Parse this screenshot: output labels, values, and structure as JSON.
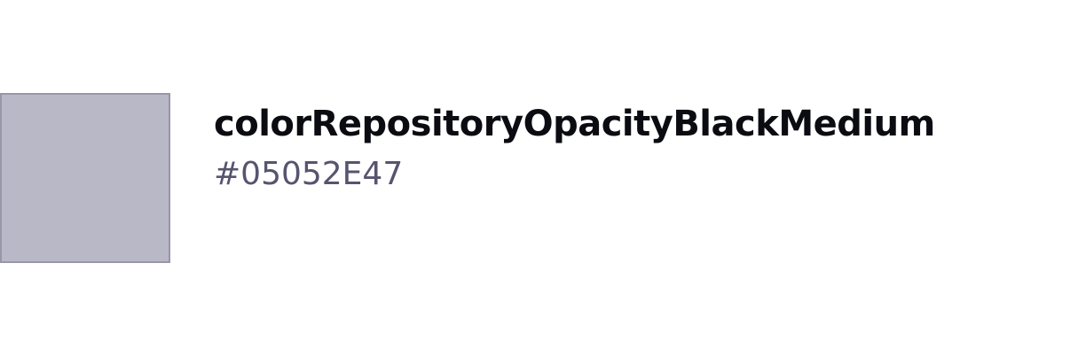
{
  "color_token": {
    "name": "colorRepositoryOpacityBlackMedium",
    "value": "#05052E47",
    "swatch_fill": "#b9b8c7",
    "swatch_border": "#9896a8",
    "name_color": "#0b0b12",
    "value_color": "#56546e"
  }
}
